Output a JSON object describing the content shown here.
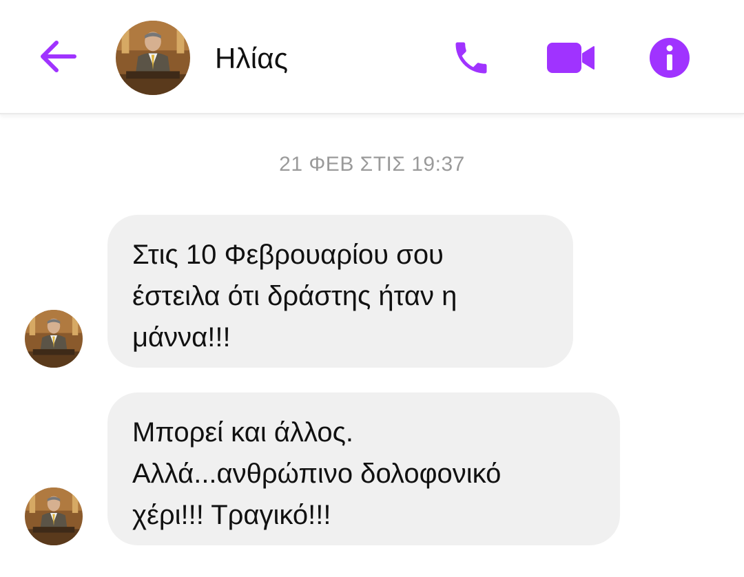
{
  "header": {
    "contact_name": "Ηλίας",
    "accent_color": "#a033ff",
    "icons": [
      "back-arrow-icon",
      "phone-icon",
      "video-camera-icon",
      "info-icon"
    ]
  },
  "thread": {
    "timestamp": "21 ΦΕΒ ΣΤΙΣ 19:37",
    "messages": [
      {
        "sender": "Ηλίας",
        "lines": [
          "Στις 10 Φεβρουαρίου σου",
          "έστειλα ότι δράστης ήταν η",
          "μάννα!!!"
        ]
      },
      {
        "sender": "Ηλίας",
        "lines": [
          "Μπορεί και άλλος.",
          "Αλλά...ανθρώπινο δολοφονικό",
          "χέρι!!! Τραγικό!!!"
        ]
      }
    ]
  }
}
